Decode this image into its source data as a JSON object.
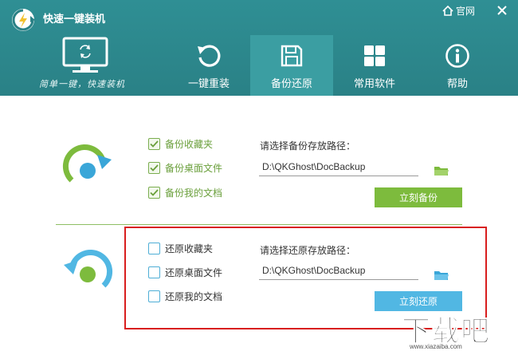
{
  "app": {
    "title": "快速一键装机",
    "slogan": "简单一键，快速装机"
  },
  "top_links": {
    "official_site": "官网"
  },
  "nav": {
    "tabs": [
      {
        "label": "一键重装",
        "icon": "refresh-icon",
        "active": false
      },
      {
        "label": "备份还原",
        "icon": "floppy-disk-icon",
        "active": true
      },
      {
        "label": "常用软件",
        "icon": "grid-icon",
        "active": false
      },
      {
        "label": "帮助",
        "icon": "info-icon",
        "active": false
      }
    ]
  },
  "backup": {
    "options": [
      {
        "label": "备份收藏夹",
        "checked": true
      },
      {
        "label": "备份桌面文件",
        "checked": true
      },
      {
        "label": "备份我的文档",
        "checked": true
      }
    ],
    "path_label": "请选择备份存放路径：",
    "path_value": "D:\\QKGhost\\DocBackup",
    "button_label": "立刻备份"
  },
  "restore": {
    "options": [
      {
        "label": "还原收藏夹",
        "checked": false
      },
      {
        "label": "还原桌面文件",
        "checked": false
      },
      {
        "label": "还原我的文档",
        "checked": false
      }
    ],
    "path_label": "请选择还原存放路径：",
    "path_value": "D:\\QKGhost\\DocBackup",
    "button_label": "立刻还原"
  },
  "watermark": {
    "text": "下载吧",
    "url": "www.xiazaiba.com"
  },
  "colors": {
    "header_bg": "#2f8f94",
    "active_tab_bg": "#3b9ea2",
    "backup_green": "#7dbb3d",
    "restore_blue": "#51b7e3",
    "highlight_red": "#d81e1e"
  }
}
